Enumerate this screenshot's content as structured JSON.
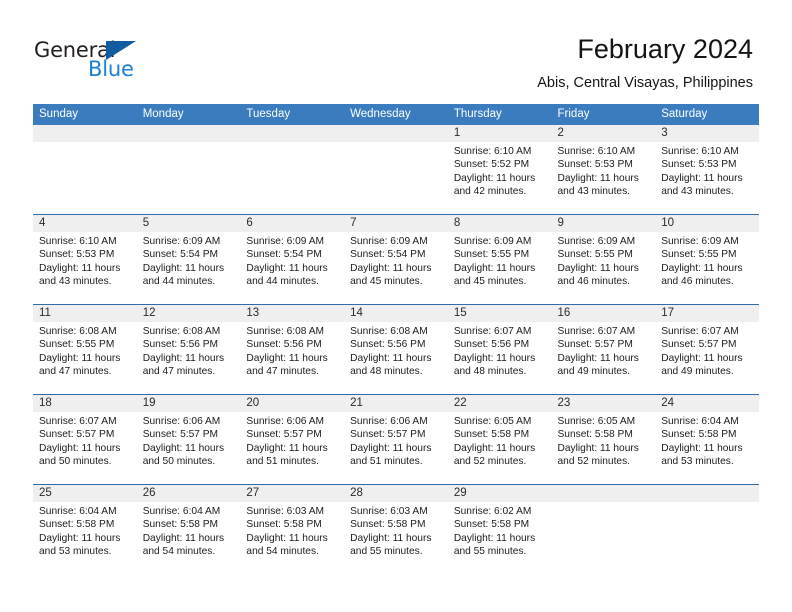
{
  "brand": {
    "name_part1": "General",
    "name_part2": "Blue",
    "triangle_color": "#135ba1",
    "blue_color": "#1a7fd4"
  },
  "header": {
    "title": "February 2024",
    "subtitle": "Abis, Central Visayas, Philippines",
    "header_bg": "#3a7cbe",
    "row_divider": "#2f6ca8",
    "number_band_bg": "#efefef"
  },
  "weekday_headers": [
    "Sunday",
    "Monday",
    "Tuesday",
    "Wednesday",
    "Thursday",
    "Friday",
    "Saturday"
  ],
  "weeks": [
    [
      {
        "day": "",
        "empty": true,
        "sunrise": "",
        "sunset": "",
        "daylight1": "",
        "daylight2": ""
      },
      {
        "day": "",
        "empty": true,
        "sunrise": "",
        "sunset": "",
        "daylight1": "",
        "daylight2": ""
      },
      {
        "day": "",
        "empty": true,
        "sunrise": "",
        "sunset": "",
        "daylight1": "",
        "daylight2": ""
      },
      {
        "day": "",
        "empty": true,
        "sunrise": "",
        "sunset": "",
        "daylight1": "",
        "daylight2": ""
      },
      {
        "day": "1",
        "empty": false,
        "sunrise": "Sunrise: 6:10 AM",
        "sunset": "Sunset: 5:52 PM",
        "daylight1": "Daylight: 11 hours",
        "daylight2": "and 42 minutes."
      },
      {
        "day": "2",
        "empty": false,
        "sunrise": "Sunrise: 6:10 AM",
        "sunset": "Sunset: 5:53 PM",
        "daylight1": "Daylight: 11 hours",
        "daylight2": "and 43 minutes."
      },
      {
        "day": "3",
        "empty": false,
        "sunrise": "Sunrise: 6:10 AM",
        "sunset": "Sunset: 5:53 PM",
        "daylight1": "Daylight: 11 hours",
        "daylight2": "and 43 minutes."
      }
    ],
    [
      {
        "day": "4",
        "empty": false,
        "sunrise": "Sunrise: 6:10 AM",
        "sunset": "Sunset: 5:53 PM",
        "daylight1": "Daylight: 11 hours",
        "daylight2": "and 43 minutes."
      },
      {
        "day": "5",
        "empty": false,
        "sunrise": "Sunrise: 6:09 AM",
        "sunset": "Sunset: 5:54 PM",
        "daylight1": "Daylight: 11 hours",
        "daylight2": "and 44 minutes."
      },
      {
        "day": "6",
        "empty": false,
        "sunrise": "Sunrise: 6:09 AM",
        "sunset": "Sunset: 5:54 PM",
        "daylight1": "Daylight: 11 hours",
        "daylight2": "and 44 minutes."
      },
      {
        "day": "7",
        "empty": false,
        "sunrise": "Sunrise: 6:09 AM",
        "sunset": "Sunset: 5:54 PM",
        "daylight1": "Daylight: 11 hours",
        "daylight2": "and 45 minutes."
      },
      {
        "day": "8",
        "empty": false,
        "sunrise": "Sunrise: 6:09 AM",
        "sunset": "Sunset: 5:55 PM",
        "daylight1": "Daylight: 11 hours",
        "daylight2": "and 45 minutes."
      },
      {
        "day": "9",
        "empty": false,
        "sunrise": "Sunrise: 6:09 AM",
        "sunset": "Sunset: 5:55 PM",
        "daylight1": "Daylight: 11 hours",
        "daylight2": "and 46 minutes."
      },
      {
        "day": "10",
        "empty": false,
        "sunrise": "Sunrise: 6:09 AM",
        "sunset": "Sunset: 5:55 PM",
        "daylight1": "Daylight: 11 hours",
        "daylight2": "and 46 minutes."
      }
    ],
    [
      {
        "day": "11",
        "empty": false,
        "sunrise": "Sunrise: 6:08 AM",
        "sunset": "Sunset: 5:55 PM",
        "daylight1": "Daylight: 11 hours",
        "daylight2": "and 47 minutes."
      },
      {
        "day": "12",
        "empty": false,
        "sunrise": "Sunrise: 6:08 AM",
        "sunset": "Sunset: 5:56 PM",
        "daylight1": "Daylight: 11 hours",
        "daylight2": "and 47 minutes."
      },
      {
        "day": "13",
        "empty": false,
        "sunrise": "Sunrise: 6:08 AM",
        "sunset": "Sunset: 5:56 PM",
        "daylight1": "Daylight: 11 hours",
        "daylight2": "and 47 minutes."
      },
      {
        "day": "14",
        "empty": false,
        "sunrise": "Sunrise: 6:08 AM",
        "sunset": "Sunset: 5:56 PM",
        "daylight1": "Daylight: 11 hours",
        "daylight2": "and 48 minutes."
      },
      {
        "day": "15",
        "empty": false,
        "sunrise": "Sunrise: 6:07 AM",
        "sunset": "Sunset: 5:56 PM",
        "daylight1": "Daylight: 11 hours",
        "daylight2": "and 48 minutes."
      },
      {
        "day": "16",
        "empty": false,
        "sunrise": "Sunrise: 6:07 AM",
        "sunset": "Sunset: 5:57 PM",
        "daylight1": "Daylight: 11 hours",
        "daylight2": "and 49 minutes."
      },
      {
        "day": "17",
        "empty": false,
        "sunrise": "Sunrise: 6:07 AM",
        "sunset": "Sunset: 5:57 PM",
        "daylight1": "Daylight: 11 hours",
        "daylight2": "and 49 minutes."
      }
    ],
    [
      {
        "day": "18",
        "empty": false,
        "sunrise": "Sunrise: 6:07 AM",
        "sunset": "Sunset: 5:57 PM",
        "daylight1": "Daylight: 11 hours",
        "daylight2": "and 50 minutes."
      },
      {
        "day": "19",
        "empty": false,
        "sunrise": "Sunrise: 6:06 AM",
        "sunset": "Sunset: 5:57 PM",
        "daylight1": "Daylight: 11 hours",
        "daylight2": "and 50 minutes."
      },
      {
        "day": "20",
        "empty": false,
        "sunrise": "Sunrise: 6:06 AM",
        "sunset": "Sunset: 5:57 PM",
        "daylight1": "Daylight: 11 hours",
        "daylight2": "and 51 minutes."
      },
      {
        "day": "21",
        "empty": false,
        "sunrise": "Sunrise: 6:06 AM",
        "sunset": "Sunset: 5:57 PM",
        "daylight1": "Daylight: 11 hours",
        "daylight2": "and 51 minutes."
      },
      {
        "day": "22",
        "empty": false,
        "sunrise": "Sunrise: 6:05 AM",
        "sunset": "Sunset: 5:58 PM",
        "daylight1": "Daylight: 11 hours",
        "daylight2": "and 52 minutes."
      },
      {
        "day": "23",
        "empty": false,
        "sunrise": "Sunrise: 6:05 AM",
        "sunset": "Sunset: 5:58 PM",
        "daylight1": "Daylight: 11 hours",
        "daylight2": "and 52 minutes."
      },
      {
        "day": "24",
        "empty": false,
        "sunrise": "Sunrise: 6:04 AM",
        "sunset": "Sunset: 5:58 PM",
        "daylight1": "Daylight: 11 hours",
        "daylight2": "and 53 minutes."
      }
    ],
    [
      {
        "day": "25",
        "empty": false,
        "sunrise": "Sunrise: 6:04 AM",
        "sunset": "Sunset: 5:58 PM",
        "daylight1": "Daylight: 11 hours",
        "daylight2": "and 53 minutes."
      },
      {
        "day": "26",
        "empty": false,
        "sunrise": "Sunrise: 6:04 AM",
        "sunset": "Sunset: 5:58 PM",
        "daylight1": "Daylight: 11 hours",
        "daylight2": "and 54 minutes."
      },
      {
        "day": "27",
        "empty": false,
        "sunrise": "Sunrise: 6:03 AM",
        "sunset": "Sunset: 5:58 PM",
        "daylight1": "Daylight: 11 hours",
        "daylight2": "and 54 minutes."
      },
      {
        "day": "28",
        "empty": false,
        "sunrise": "Sunrise: 6:03 AM",
        "sunset": "Sunset: 5:58 PM",
        "daylight1": "Daylight: 11 hours",
        "daylight2": "and 55 minutes."
      },
      {
        "day": "29",
        "empty": false,
        "sunrise": "Sunrise: 6:02 AM",
        "sunset": "Sunset: 5:58 PM",
        "daylight1": "Daylight: 11 hours",
        "daylight2": "and 55 minutes."
      },
      {
        "day": "",
        "empty": true,
        "sunrise": "",
        "sunset": "",
        "daylight1": "",
        "daylight2": ""
      },
      {
        "day": "",
        "empty": true,
        "sunrise": "",
        "sunset": "",
        "daylight1": "",
        "daylight2": ""
      }
    ]
  ]
}
